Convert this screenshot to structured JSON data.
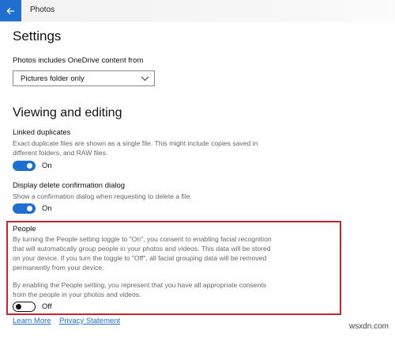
{
  "titlebar": {
    "app_title": "Photos",
    "back_icon": "back-arrow-icon"
  },
  "page": {
    "title": "Settings"
  },
  "onedrive": {
    "label": "Photos includes OneDrive content from",
    "dropdown_value": "Pictures folder only"
  },
  "viewing": {
    "title": "Viewing and editing",
    "linked": {
      "label": "Linked duplicates",
      "desc_line1": "Exact duplicate files are shown as a single file. This might include copies saved in",
      "desc_line2": "different folders, and RAW files.",
      "state": "On"
    },
    "delete_confirm": {
      "label": "Display delete confirmation dialog",
      "desc": "Show a confirmation dialog when requesting to delete a file.",
      "state": "On"
    }
  },
  "people": {
    "label": "People",
    "p1_line1": "By turning the People setting toggle to \"On\", you consent to enabling facial recognition",
    "p1_line2": "that will automatically group people in your photos and videos. This data will be stored",
    "p1_line3": "on your device. If you turn the toggle to \"Off\", all facial grouping data will be removed",
    "p1_line4": "permanently from your device.",
    "p2_line1": "By enabling the People setting, you represent that you have all appropriate consents",
    "p2_line2": "from the people in your photos and videos.",
    "state": "Off"
  },
  "links": {
    "learn_more": "Learn More",
    "privacy": "Privacy Statement"
  },
  "watermark": "wsxdn.com",
  "colors": {
    "accent": "#1f6fd1",
    "highlight_border": "#c8242c"
  }
}
